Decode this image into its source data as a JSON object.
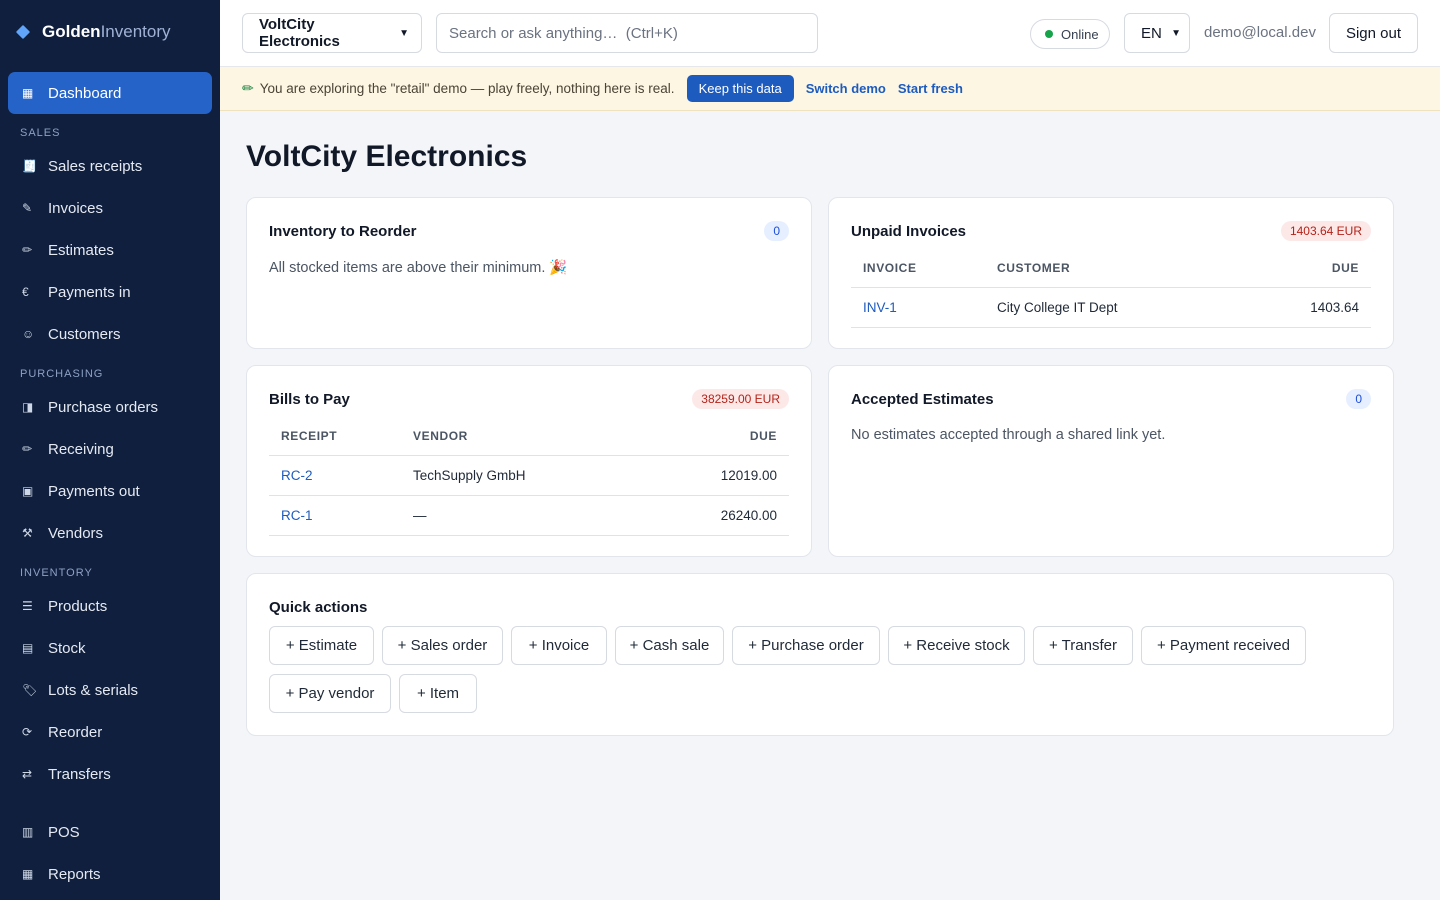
{
  "brand": {
    "bold": "Golden",
    "light": "Inventory"
  },
  "sidebar": {
    "dashboard": {
      "label": "Dashboard",
      "icon": "▦"
    },
    "sections": {
      "sales": "SALES",
      "purchasing": "PURCHASING",
      "inventory": "INVENTORY"
    },
    "sales_items": [
      {
        "label": "Sales receipts",
        "icon": "🧾"
      },
      {
        "label": "Invoices",
        "icon": "✎"
      },
      {
        "label": "Estimates",
        "icon": "✏"
      },
      {
        "label": "Payments in",
        "icon": "€"
      },
      {
        "label": "Customers",
        "icon": "☺"
      }
    ],
    "purchasing_items": [
      {
        "label": "Purchase orders",
        "icon": "◨"
      },
      {
        "label": "Receiving",
        "icon": "✏"
      },
      {
        "label": "Payments out",
        "icon": "▣"
      },
      {
        "label": "Vendors",
        "icon": "⚒"
      }
    ],
    "inventory_items": [
      {
        "label": "Products",
        "icon": "☰"
      },
      {
        "label": "Stock",
        "icon": "▤"
      },
      {
        "label": "Lots & serials",
        "icon": "🏷"
      },
      {
        "label": "Reorder",
        "icon": "⟳"
      },
      {
        "label": "Transfers",
        "icon": "⇄"
      }
    ],
    "bottom_items": [
      {
        "label": "POS",
        "icon": "▥"
      },
      {
        "label": "Reports",
        "icon": "▦"
      }
    ]
  },
  "header": {
    "company": "VoltCity Electronics",
    "search_placeholder": "Search or ask anything…  (Ctrl+K)",
    "status": "Online",
    "language": "EN",
    "user_email": "demo@local.dev",
    "signout": "Sign out"
  },
  "banner": {
    "icon": "✏",
    "text": "You are exploring the \"retail\" demo — play freely, nothing here is real.",
    "keep_label": "Keep this data",
    "switch_label": "Switch demo",
    "fresh_label": "Start fresh"
  },
  "page_title": "VoltCity Electronics",
  "reorder": {
    "title": "Inventory to Reorder",
    "count": "0",
    "note": "All stocked items are above their minimum. 🎉"
  },
  "unpaid": {
    "title": "Unpaid Invoices",
    "total": "1403.64 EUR",
    "headers": {
      "doc": "INVOICE",
      "party": "CUSTOMER",
      "due": "DUE"
    },
    "rows": [
      {
        "doc": "INV-1",
        "party": "City College IT Dept",
        "due": "1403.64"
      }
    ]
  },
  "bills": {
    "title": "Bills to Pay",
    "total": "38259.00 EUR",
    "headers": {
      "doc": "RECEIPT",
      "party": "VENDOR",
      "due": "DUE"
    },
    "rows": [
      {
        "doc": "RC-2",
        "party": "TechSupply GmbH",
        "due": "12019.00"
      },
      {
        "doc": "RC-1",
        "party": "—",
        "due": "26240.00"
      }
    ]
  },
  "estimates": {
    "title": "Accepted Estimates",
    "count": "0",
    "note": "No estimates accepted through a shared link yet."
  },
  "quick_actions": {
    "title": "Quick actions",
    "buttons": [
      "+ Estimate",
      "+ Sales order",
      "+ Invoice",
      "+ Cash sale",
      "+ Purchase order",
      "+ Receive stock",
      "+ Transfer",
      "+ Payment received",
      "+ Pay vendor",
      "+ Item"
    ]
  },
  "colors": {
    "sidebar": "#0f1f3d",
    "accent": "#2563c9",
    "link": "#1d5bbf",
    "banner": "#fdf6e3",
    "online": "#16a34a"
  }
}
